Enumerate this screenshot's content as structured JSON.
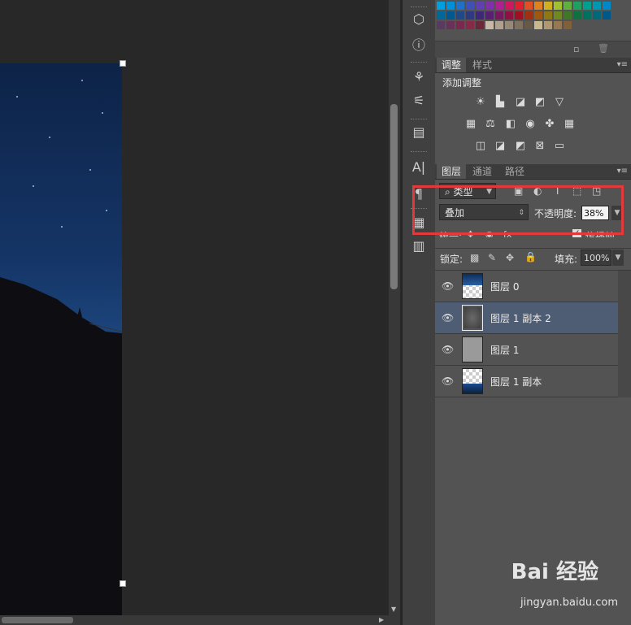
{
  "adjustments": {
    "tabs": [
      "调整",
      "样式"
    ],
    "title": "添加调整"
  },
  "layers_panel": {
    "tabs": [
      "图层",
      "通道",
      "路径"
    ],
    "filter_label": "类型",
    "blend_mode": "叠加",
    "opacity_label": "不透明度:",
    "opacity_value": "38%",
    "unify_label": "统一:",
    "propagate_label": "传播帧",
    "lock_label": "锁定:",
    "fill_label": "填充:",
    "fill_value": "100%",
    "layers": [
      {
        "name": "图层 0",
        "selected": false
      },
      {
        "name": "图层 1 副本 2",
        "selected": true
      },
      {
        "name": "图层 1",
        "selected": false
      },
      {
        "name": "图层 1 副本",
        "selected": false
      }
    ]
  },
  "watermark": {
    "brand": "Bai 经验",
    "url": "jingyan.baidu.com"
  },
  "colors": {
    "highlight": "#e23a3a",
    "selected_layer": "#4e5d74",
    "panel_bg": "#535353"
  }
}
